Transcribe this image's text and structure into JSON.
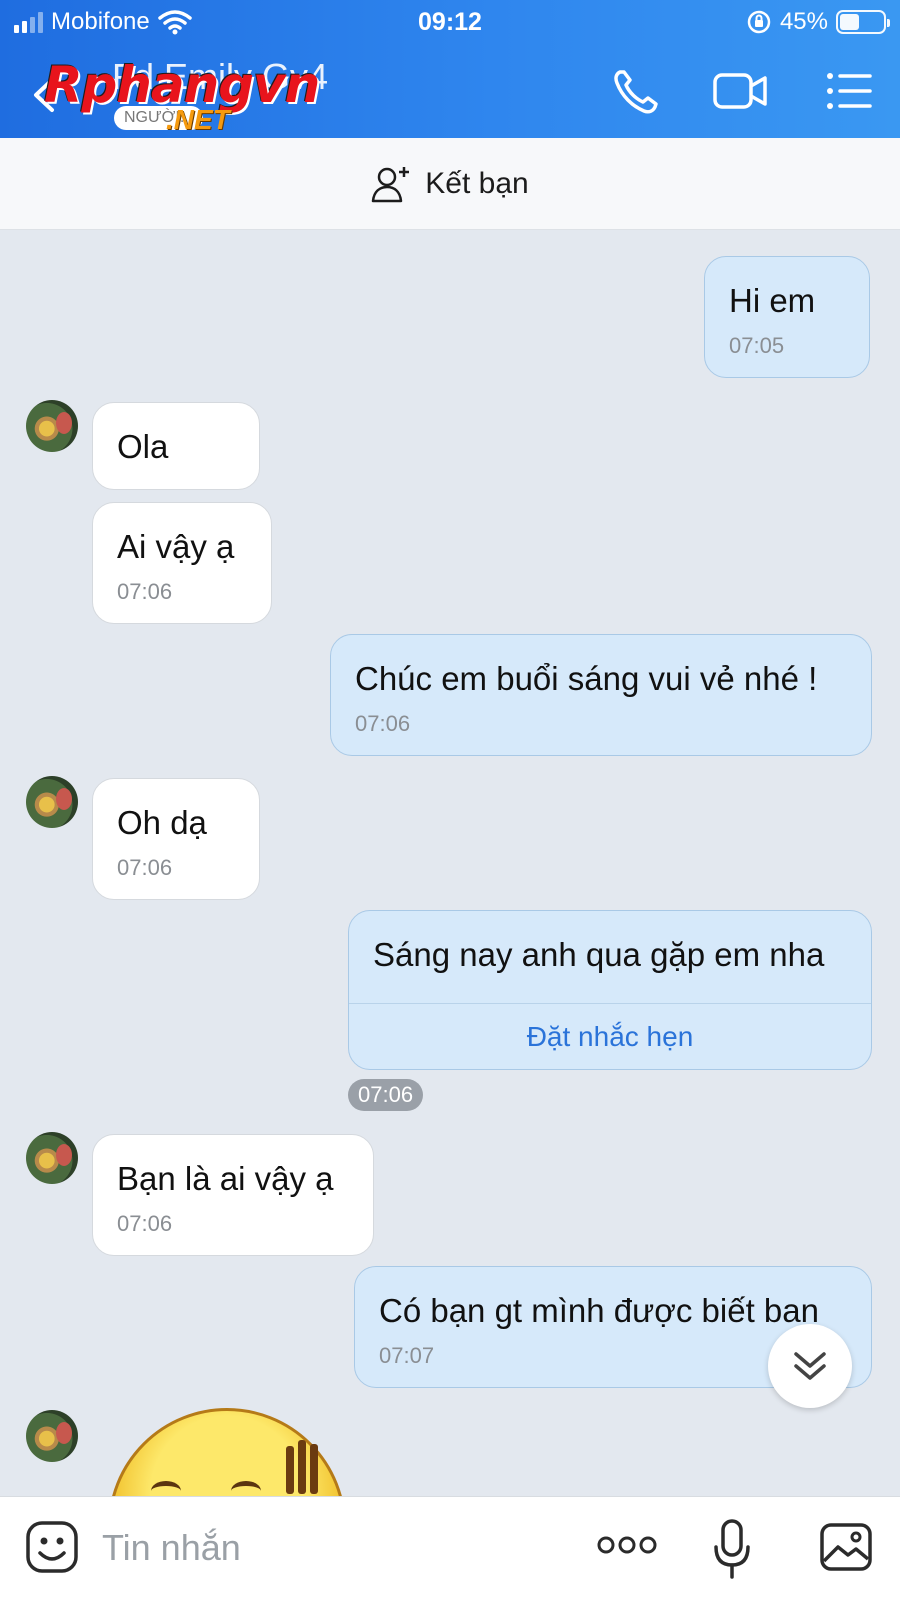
{
  "status_bar": {
    "carrier": "Mobifone",
    "time": "09:12",
    "battery_text": "45%",
    "battery_level": 0.45,
    "signal_bars": 2
  },
  "header": {
    "contact_name": "Fd Emily Gv4",
    "logo_text": "Rphangvn",
    "logo_subtext": "NGƯỜI...",
    "logo_suffix": ".NET",
    "icons": [
      "back-chevron-icon",
      "phone-icon",
      "video-camera-icon",
      "menu-list-icon"
    ]
  },
  "add_friend": {
    "label": "Kết bạn",
    "icon": "add-person-icon"
  },
  "messages": [
    {
      "side": "out",
      "text": "Hi em",
      "time": "07:05"
    },
    {
      "side": "in",
      "text": "Ola",
      "time": ""
    },
    {
      "side": "in",
      "text": "Ai vậy ạ",
      "time": "07:06"
    },
    {
      "side": "out",
      "text": "Chúc em buổi sáng vui vẻ nhé !",
      "time": "07:06"
    },
    {
      "side": "in",
      "text": "Oh dạ",
      "time": "07:06"
    },
    {
      "side": "out",
      "text": "Sáng nay anh qua gặp em nha",
      "time": "07:06",
      "action": "Đặt nhắc hẹn"
    },
    {
      "side": "in",
      "text": "Bạn là ai vậy ạ",
      "time": "07:06"
    },
    {
      "side": "out",
      "text": "Có bạn gt mình được biết ban",
      "time": "07:07"
    }
  ],
  "input_bar": {
    "placeholder": "Tin nhắn",
    "icons": [
      "emoji-icon",
      "more-options-icon",
      "microphone-icon",
      "image-icon"
    ]
  },
  "colors": {
    "header_start": "#1f6de0",
    "header_end": "#3a98f2",
    "outgoing_bubble": "#d6e9fa",
    "incoming_bubble": "#ffffff",
    "chat_background": "#e3e8ef",
    "link": "#2a73d9"
  }
}
